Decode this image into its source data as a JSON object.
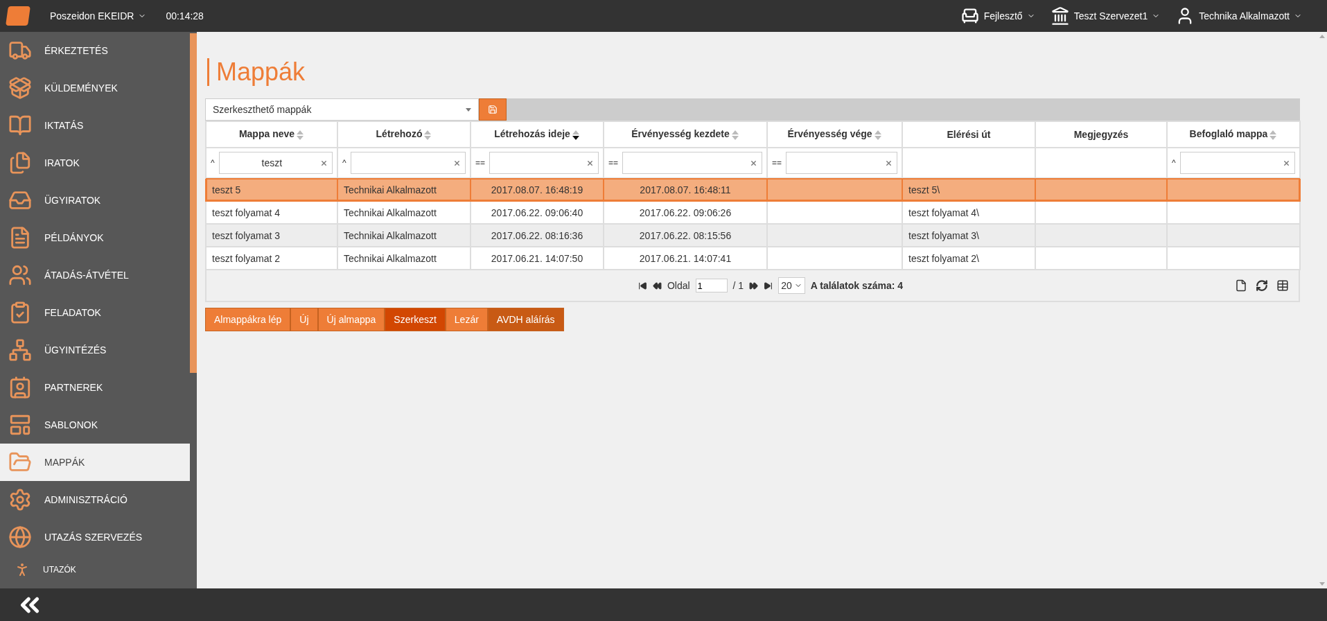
{
  "topbar": {
    "app": "Poszeidon EKEIDR",
    "time": "00:14:28",
    "menus": [
      {
        "kind": "role",
        "label": "Fejlesztő"
      },
      {
        "kind": "org",
        "label": "Teszt Szervezet1"
      },
      {
        "kind": "user",
        "label": "Technika Alkalmazott"
      }
    ]
  },
  "sidebar": {
    "items": [
      {
        "kind": "arrival",
        "label": "ÉRKEZTETÉS",
        "selected": false
      },
      {
        "kind": "parcels",
        "label": "KÜLDEMÉNYEK",
        "selected": false
      },
      {
        "kind": "book",
        "label": "IKTATÁS",
        "selected": false
      },
      {
        "kind": "docs",
        "label": "IRATOK",
        "selected": false
      },
      {
        "kind": "tray",
        "label": "ÜGYIRATOK",
        "selected": false
      },
      {
        "kind": "copies",
        "label": "PÉLDÁNYOK",
        "selected": false
      },
      {
        "kind": "handover",
        "label": "ÁTADÁS-ÁTVÉTEL",
        "selected": false
      },
      {
        "kind": "tasks",
        "label": "FELADATOK",
        "selected": false
      },
      {
        "kind": "workflow",
        "label": "ÜGYINTÉZÉS",
        "selected": false
      },
      {
        "kind": "partners",
        "label": "PARTNEREK",
        "selected": false
      },
      {
        "kind": "templates",
        "label": "SABLONOK",
        "selected": false
      },
      {
        "kind": "folders",
        "label": "MAPPÁK",
        "selected": true
      },
      {
        "kind": "admin",
        "label": "ADMINISZTRÁCIÓ",
        "selected": false
      },
      {
        "kind": "travel",
        "label": "UTAZÁS SZERVEZÉS",
        "selected": false
      },
      {
        "kind": "traveler",
        "label": "UTAZÓK",
        "selected": false
      }
    ]
  },
  "page": {
    "title": "Mappák",
    "view_select": "Szerkeszthető mappák"
  },
  "table": {
    "columns": [
      {
        "label": "Mappa neve",
        "sortable": true,
        "sorted_descending": false,
        "filter": {
          "op": "^",
          "value": "teszt"
        }
      },
      {
        "label": "Létrehozó",
        "sortable": true,
        "sorted_descending": false,
        "filter": {
          "op": "^"
        }
      },
      {
        "label": "Létrehozás ideje",
        "sortable": true,
        "sorted_descending": true,
        "filter": {
          "op": "=="
        }
      },
      {
        "label": "Érvényesség kezdete",
        "sortable": true,
        "sorted_descending": false,
        "filter": {
          "op": "=="
        }
      },
      {
        "label": "Érvényesség vége",
        "sortable": true,
        "sorted_descending": false,
        "filter": {
          "op": "=="
        }
      },
      {
        "label": "Elérési út",
        "sortable": false
      },
      {
        "label": "Megjegyzés",
        "sortable": false
      },
      {
        "label": "Befoglaló mappa",
        "sortable": true,
        "sorted_descending": false,
        "filter": {
          "op": "^"
        }
      }
    ],
    "rows": [
      {
        "selected": true,
        "cells": [
          "teszt 5",
          "Technikai Alkalmazott",
          "2017.08.07. 16:48:19",
          "2017.08.07. 16:48:11",
          "",
          "teszt 5\\",
          "",
          ""
        ]
      },
      {
        "selected": false,
        "cells": [
          "teszt folyamat 4",
          "Technikai Alkalmazott",
          "2017.06.22. 09:06:40",
          "2017.06.22. 09:06:26",
          "",
          "teszt folyamat 4\\",
          "",
          ""
        ]
      },
      {
        "selected": false,
        "cells": [
          "teszt folyamat 3",
          "Technikai Alkalmazott",
          "2017.06.22. 08:16:36",
          "2017.06.22. 08:15:56",
          "",
          "teszt folyamat 3\\",
          "",
          ""
        ]
      },
      {
        "selected": false,
        "cells": [
          "teszt folyamat 2",
          "Technikai Alkalmazott",
          "2017.06.21. 14:07:50",
          "2017.06.21. 14:07:41",
          "",
          "teszt folyamat 2\\",
          "",
          ""
        ]
      }
    ]
  },
  "pager": {
    "page_label": "Oldal",
    "page": "1",
    "of": "/ 1",
    "page_size": "20",
    "total": "A találatok száma: 4"
  },
  "actions": [
    {
      "label": "Almappákra lép",
      "color": "#ee7d37"
    },
    {
      "label": "Új",
      "color": "#ee7d37"
    },
    {
      "label": "Új almappa",
      "color": "#ee7d37"
    },
    {
      "label": "Szerkeszt",
      "color": "#d24702"
    },
    {
      "label": "Lezár",
      "color": "#ee7d37"
    },
    {
      "label": "AVDH aláírás",
      "color": "#c85a14"
    }
  ]
}
